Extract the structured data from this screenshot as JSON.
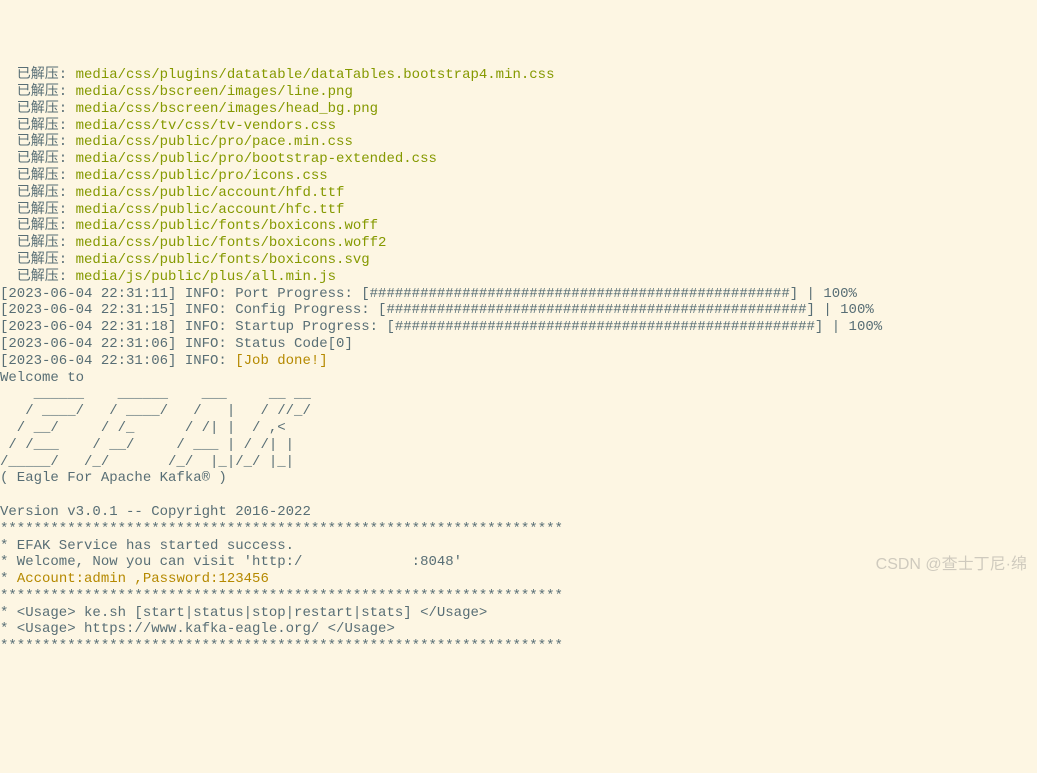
{
  "extract_prefix": "  已解压: ",
  "extracted_files": [
    "media/css/plugins/datatable/dataTables.bootstrap4.min.css",
    "media/css/bscreen/images/line.png",
    "media/css/bscreen/images/head_bg.png",
    "media/css/tv/css/tv-vendors.css",
    "media/css/public/pro/pace.min.css",
    "media/css/public/pro/bootstrap-extended.css",
    "media/css/public/pro/icons.css",
    "media/css/public/account/hfd.ttf",
    "media/css/public/account/hfc.ttf",
    "media/css/public/fonts/boxicons.woff",
    "media/css/public/fonts/boxicons.woff2",
    "media/css/public/fonts/boxicons.svg",
    "media/js/public/plus/all.min.js"
  ],
  "progress_lines": [
    "[2023-06-04 22:31:11] INFO: Port Progress: [##################################################] | 100%",
    "[2023-06-04 22:31:15] INFO: Config Progress: [##################################################] | 100%",
    "[2023-06-04 22:31:18] INFO: Startup Progress: [##################################################] | 100%"
  ],
  "status_line": "[2023-06-04 22:31:06] INFO: Status Code[0]",
  "job_done_prefix": "[2023-06-04 22:31:06] INFO: ",
  "job_done_text": "[Job done!]",
  "welcome": "Welcome to",
  "ascii_art": "    ______    ______    ___     __ __\n   / ____/   / ____/   /   |   / //_/\n  / __/     / /_      / /| |  / ,<   \n / /___    / __/     / ___ | / /| |  \n/_____/   /_/       /_/  |_|/_/ |_|  \n( Eagle For Apache Kafka® )",
  "blank": "",
  "version_line": "Version v3.0.1 -- Copyright 2016-2022",
  "star_line": "*******************************************************************",
  "service_started": "* EFAK Service has started success.",
  "welcome_visit_prefix": "* Welcome, Now you can visit 'http:/",
  "welcome_visit_suffix": "             :8048'",
  "account_prefix": "* ",
  "account_text": "Account:admin ,Password:123456",
  "usage1": "* <Usage> ke.sh [start|status|stop|restart|stats] </Usage>",
  "usage2": "* <Usage> https://www.kafka-eagle.org/ </Usage>",
  "watermark": "CSDN @查士丁尼·绵"
}
